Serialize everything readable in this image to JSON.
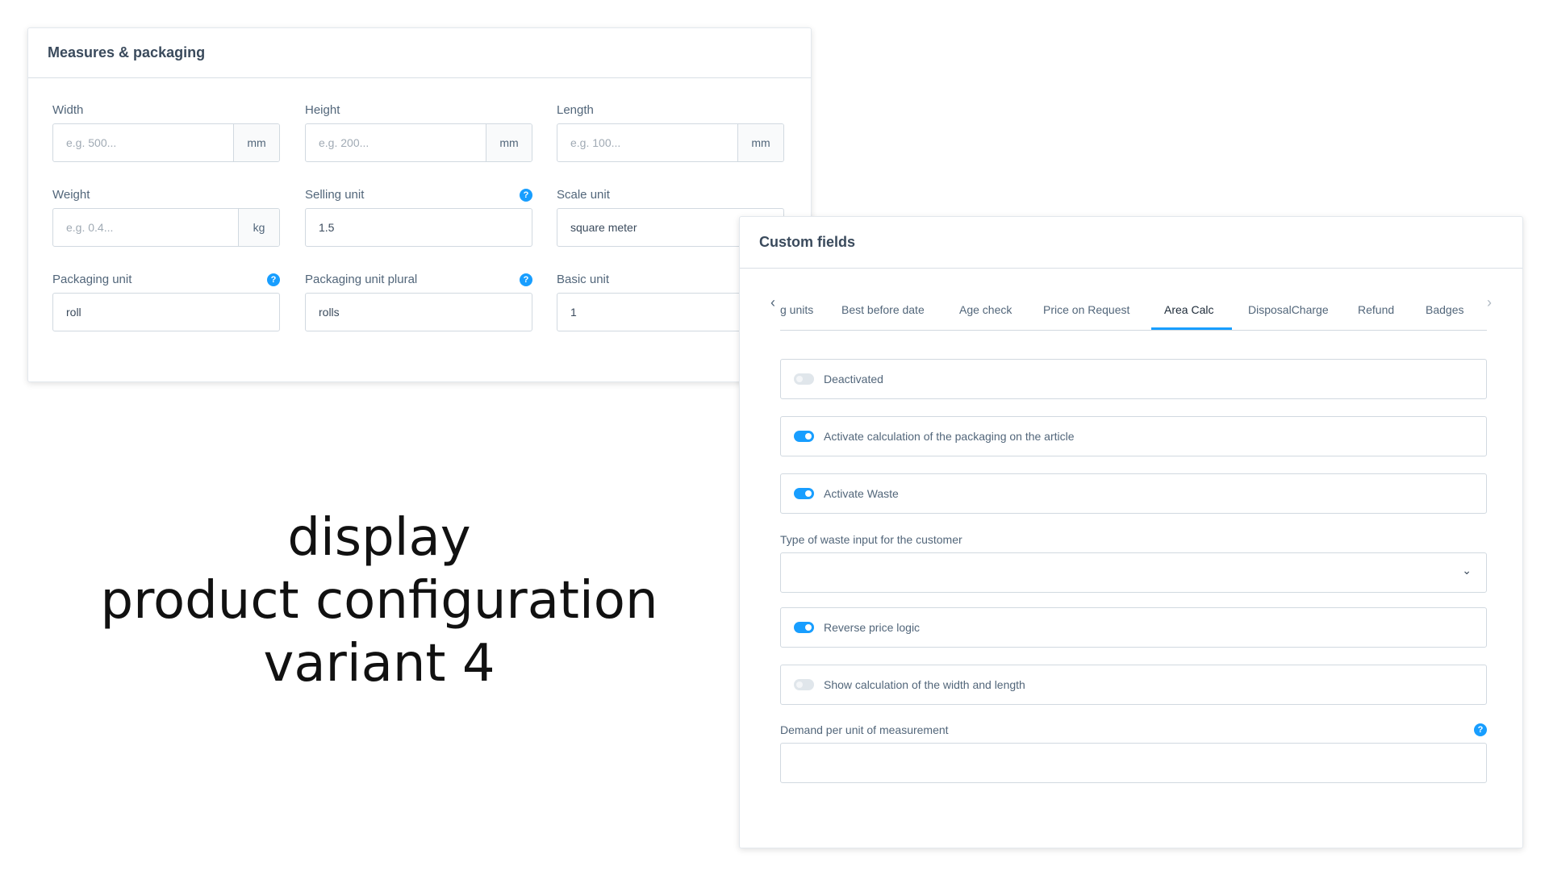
{
  "measures": {
    "title": "Measures & packaging",
    "fields": {
      "width": {
        "label": "Width",
        "placeholder": "e.g. 500...",
        "suffix": "mm"
      },
      "height": {
        "label": "Height",
        "placeholder": "e.g. 200...",
        "suffix": "mm"
      },
      "length": {
        "label": "Length",
        "placeholder": "e.g. 100...",
        "suffix": "mm"
      },
      "weight": {
        "label": "Weight",
        "placeholder": "e.g. 0.4...",
        "suffix": "kg"
      },
      "selling_unit": {
        "label": "Selling unit",
        "value": "1.5"
      },
      "scale_unit": {
        "label": "Scale unit",
        "value": "square meter"
      },
      "packaging_unit": {
        "label": "Packaging unit",
        "value": "roll"
      },
      "packaging_unit_plural": {
        "label": "Packaging unit plural",
        "value": "rolls"
      },
      "basic_unit": {
        "label": "Basic unit",
        "value": "1"
      }
    },
    "help_icon": "?"
  },
  "caption": {
    "line1": "display",
    "line2": "product configuration",
    "line3": "variant 4"
  },
  "custom_fields": {
    "title": "Custom fields",
    "tabs": [
      "g units",
      "Best before date",
      "Age check",
      "Price on Request",
      "Area Calc",
      "DisposalCharge",
      "Refund",
      "Badges"
    ],
    "active_tab": "Area Calc",
    "switches": {
      "deactivated": {
        "label": "Deactivated",
        "on": false
      },
      "activate_calc": {
        "label": "Activate calculation of the packaging on the article",
        "on": true
      },
      "activate_waste": {
        "label": "Activate Waste",
        "on": true
      },
      "reverse_price": {
        "label": "Reverse price logic",
        "on": true
      },
      "show_calc": {
        "label": "Show calculation of the width and length",
        "on": false
      }
    },
    "waste_type_label": "Type of waste input for the customer",
    "waste_type_value": "",
    "demand_label": "Demand per unit of measurement",
    "demand_value": ""
  },
  "colors": {
    "accent": "#189eff",
    "border": "#d1d9e0",
    "text": "#52667a"
  }
}
